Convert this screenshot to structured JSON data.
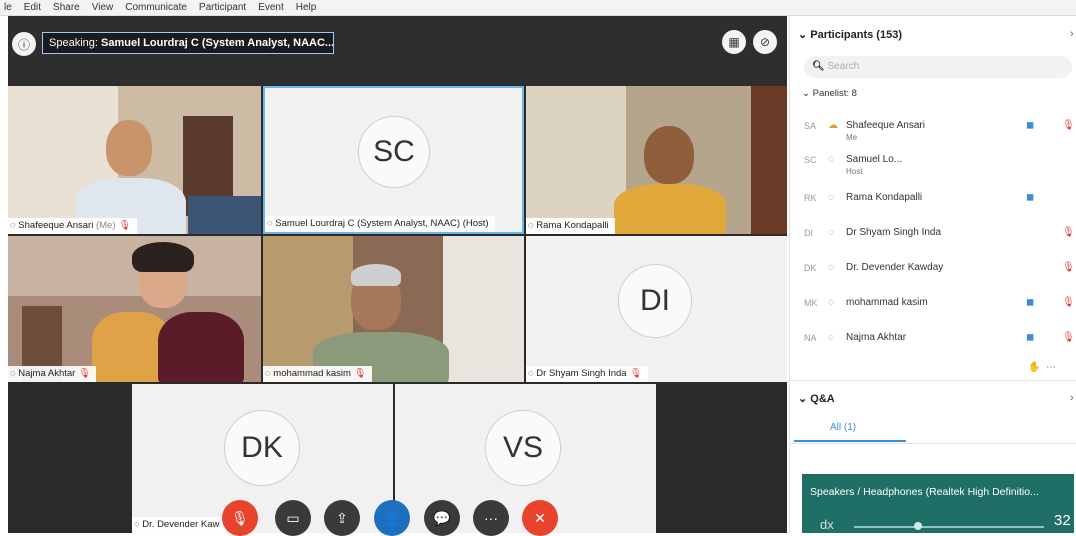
{
  "menu": [
    "le",
    "Edit",
    "Share",
    "View",
    "Communicate",
    "Participant",
    "Event",
    "Help"
  ],
  "speaking": {
    "prefix": "Speaking:",
    "name": "Samuel Lourdraj C (System Analyst, NAAC..."
  },
  "tiles": {
    "t1": {
      "name": "Shafeeque Ansari",
      "tag": "(Me)"
    },
    "t2": {
      "initials": "SC",
      "name": "Samuel Lourdraj C (System Analyst, NAAC) (Host)"
    },
    "t3": {
      "name": "Rama Kondapalli"
    },
    "t4": {
      "name": "Najma Akhtar"
    },
    "t5": {
      "name": "mohammad kasim"
    },
    "t6": {
      "initials": "DI",
      "name": "Dr Shyam Singh Inda"
    },
    "t7": {
      "initials": "DK",
      "name": "Dr. Devender Kaw"
    },
    "t8": {
      "initials": "VS"
    }
  },
  "controls": {
    "mute": "🎙",
    "video": "▭",
    "share": "⇪",
    "participants": "👤",
    "chat": "💬",
    "more": "···",
    "end": "✕"
  },
  "panel": {
    "participants_title": "Participants (153)",
    "search_placeholder": "Search",
    "panelist_header": "Panelist: 8",
    "rows": [
      {
        "ini": "SA",
        "name": "Shafeeque Ansari",
        "sub": "Me"
      },
      {
        "ini": "SC",
        "name": "Samuel Lo...",
        "sub": "Host"
      },
      {
        "ini": "RK",
        "name": "Rama Kondapalli",
        "sub": ""
      },
      {
        "ini": "DI",
        "name": "Dr Shyam Singh Inda",
        "sub": ""
      },
      {
        "ini": "DK",
        "name": "Dr. Devender Kawday",
        "sub": ""
      },
      {
        "ini": "MK",
        "name": "mohammad kasim",
        "sub": ""
      },
      {
        "ini": "NA",
        "name": "Najma Akhtar",
        "sub": ""
      }
    ],
    "qa_title": "Q&A",
    "qa_tab": "All (1)",
    "audio_text": "Speakers / Headphones (Realtek High Definitio...",
    "audio_prefix": "dx",
    "audio_value": "32"
  },
  "colors": {
    "accent": "#3b8fd8",
    "end_call": "#e8432c",
    "participants_btn": "#1f6fbf",
    "audio_bg": "#1f6f66"
  }
}
